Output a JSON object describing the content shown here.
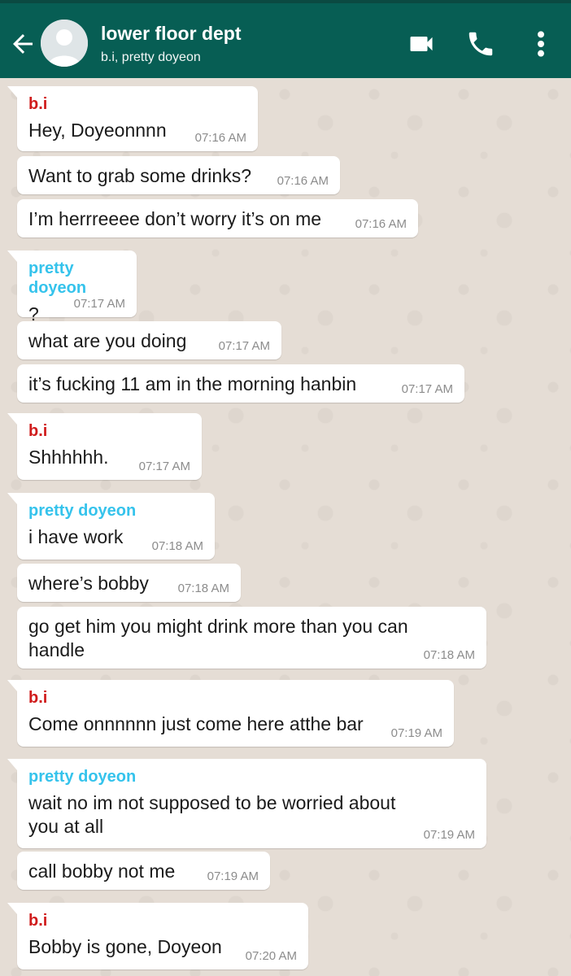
{
  "header": {
    "title": "lower floor dept",
    "subtitle": "b.i, pretty doyeon",
    "bg_color": "#075e54"
  },
  "colors": {
    "bi": "#d01c1c",
    "doyeon": "#35c3ec"
  },
  "messages": [
    {
      "sender": "b.i",
      "text": "Hey, Doyeonnnn",
      "time": "07:16 AM"
    },
    {
      "sender": "",
      "text": "Want to grab some drinks?",
      "time": "07:16 AM"
    },
    {
      "sender": "",
      "text": "I’m herrreeee don’t worry it’s on me",
      "time": "07:16 AM"
    },
    {
      "sender": "pretty doyeon",
      "text": "?",
      "time": "07:17 AM"
    },
    {
      "sender": "",
      "text": "what are you doing",
      "time": "07:17 AM"
    },
    {
      "sender": "",
      "text": "it’s fucking 11 am in the morning hanbin",
      "time": "07:17 AM"
    },
    {
      "sender": "b.i",
      "text": "Shhhhhh.",
      "time": "07:17 AM"
    },
    {
      "sender": "pretty doyeon",
      "text": "i have work",
      "time": "07:18 AM"
    },
    {
      "sender": "",
      "text": "where’s bobby",
      "time": "07:18 AM"
    },
    {
      "sender": "",
      "text": "go get him you might drink more than you can handle",
      "time": "07:18 AM"
    },
    {
      "sender": "b.i",
      "text": "Come onnnnnn just come here atthe bar",
      "time": "07:19 AM"
    },
    {
      "sender": "pretty doyeon",
      "text": "wait no im not supposed to be worried about you at all",
      "time": "07:19 AM"
    },
    {
      "sender": "",
      "text": "call bobby not me",
      "time": "07:19 AM"
    },
    {
      "sender": "b.i",
      "text": "Bobby is gone, Doyeon",
      "time": "07:20 AM"
    }
  ]
}
